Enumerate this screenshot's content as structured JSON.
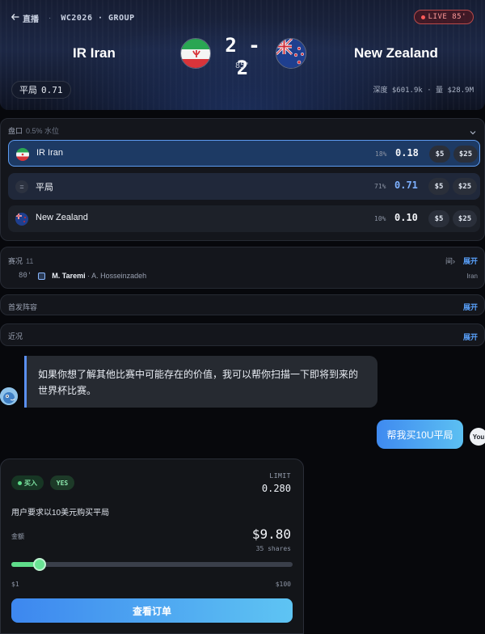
{
  "header": {
    "back_label": "直播",
    "competition": "WC2026 · GROUP",
    "live_badge": "LIVE 85'"
  },
  "match": {
    "home_team": "IR Iran",
    "away_team": "New Zealand",
    "score": "2 - 2",
    "minute": "85'",
    "draw_label": "平局",
    "draw_price": "0.71",
    "stats": "深度 $601.9k · 量 $28.9M"
  },
  "market": {
    "title": "盘口",
    "subtitle": "0.5% 水位",
    "outcomes": [
      {
        "name": "IR Iran",
        "pct": "18%",
        "price": "0.18",
        "bet_small": "$5",
        "bet_large": "$25",
        "selected": true
      },
      {
        "name": "平局",
        "icon": "=",
        "pct": "71%",
        "price": "0.71",
        "bet_small": "$5",
        "bet_large": "$25"
      },
      {
        "name": "New Zealand",
        "pct": "10%",
        "price": "0.10",
        "bet_small": "$5",
        "bet_large": "$25"
      }
    ]
  },
  "situation": {
    "title": "赛况",
    "count": "11",
    "hint": "间›",
    "expand": "展开",
    "event": {
      "minute": "80'",
      "player_in": "M. Taremi",
      "player_out": "· A. Hosseinzadeh",
      "team": "Iran"
    }
  },
  "lineup": {
    "title": "首发阵容",
    "expand": "展开"
  },
  "form": {
    "title": "近况",
    "expand": "展开"
  },
  "chat": {
    "assistant_message": "如果你想了解其他比赛中可能存在的价值，我可以帮你扫描一下即将到来的世界杯比赛。",
    "user_message": "帮我买10U平局",
    "user_avatar": "You"
  },
  "order": {
    "side_chip": "买入",
    "outcome_chip": "YES",
    "limit_label": "LIMIT",
    "limit_price": "0.280",
    "instruction": "用户要求以10美元购买平局",
    "amount_label": "金额",
    "amount": "$9.80",
    "shares": "35 shares",
    "slider_min": "$1",
    "slider_max": "$100",
    "slider_fraction": 0.1,
    "button_label": "查看订单"
  },
  "colors": {
    "accent_blue": "#5aa3ff",
    "buy_green": "#5fdc8a",
    "live_red": "#ff5a5a",
    "selected_border": "#5d9bf0"
  },
  "icons": [
    "back-arrow-icon",
    "iran-flag-icon",
    "new-zealand-flag-icon",
    "chevron-down-icon",
    "substitution-icon",
    "bot-avatar-icon",
    "live-dot-icon"
  ]
}
